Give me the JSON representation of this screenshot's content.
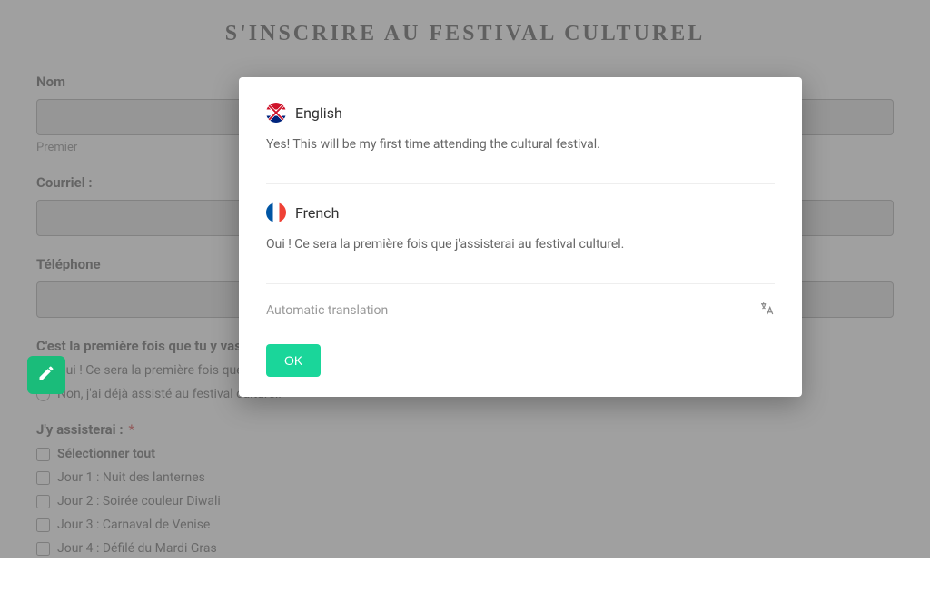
{
  "page": {
    "title": "S'INSCRIRE AU FESTIVAL CULTUREL"
  },
  "form": {
    "name": {
      "label": "Nom",
      "sub_first": "Premier",
      "value": ""
    },
    "email": {
      "label": "Courriel :",
      "value": ""
    },
    "phone": {
      "label": "Téléphone",
      "value": ""
    },
    "first_time": {
      "label": "C'est la première fois que tu y vas ?",
      "required_marker": "*",
      "options": [
        "Oui ! Ce sera la première fois que j'assisterai au festival culturel.",
        "Non, j'ai déjà assisté au festival culturel."
      ]
    },
    "attend": {
      "label": "J'y assisterai  :",
      "required_marker": "*",
      "select_all": "Sélectionner tout",
      "days": [
        "Jour 1 : Nuit des lanternes",
        "Jour 2 : Soirée couleur Diwali",
        "Jour 3 : Carnaval de Venise",
        "Jour 4 : Défilé du Mardi Gras"
      ]
    }
  },
  "modal": {
    "english": {
      "lang": "English",
      "text": "Yes! This will be my first time attending the cultural festival."
    },
    "french": {
      "lang": "French",
      "text": "Oui ! Ce sera la première fois que j'assisterai au festival culturel."
    },
    "auto_label": "Automatic translation",
    "ok": "OK"
  }
}
